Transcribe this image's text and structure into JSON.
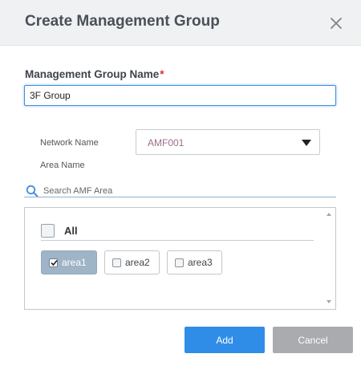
{
  "dialog": {
    "title": "Create Management Group",
    "close_icon": "close-icon"
  },
  "form": {
    "group_name_label": "Management Group Name",
    "required_mark": "*",
    "group_name_value": "3F Group",
    "network_label": "Network Name",
    "network_selected": "AMF001",
    "area_label": "Area Name"
  },
  "search": {
    "placeholder": "Search AMF Area",
    "icon": "search-icon"
  },
  "area_list": {
    "all_label": "All",
    "all_checked": false,
    "items": [
      {
        "label": "area1",
        "checked": true
      },
      {
        "label": "area2",
        "checked": false
      },
      {
        "label": "area3",
        "checked": false
      }
    ]
  },
  "buttons": {
    "add_label": "Add",
    "cancel_label": "Cancel"
  },
  "colors": {
    "accent": "#2f8de8",
    "cancel": "#a9abaf",
    "selected_chip": "#9fb4c7",
    "required": "#d9313b"
  }
}
